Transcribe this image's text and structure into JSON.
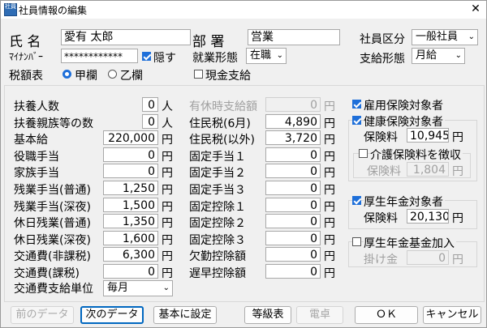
{
  "window": {
    "title": "社員情報の編集",
    "icon_text": "社員",
    "close_glyph": "✕"
  },
  "header": {
    "name_label": "氏 名",
    "name_value": "愛有 太郎",
    "mynumber_label": "ﾏｲﾅﾝﾊﾞｰ",
    "mynumber_value": "************",
    "hide_label": "隠す",
    "hide_checked": true,
    "tax_table_label": "税額表",
    "tax_kou": "甲欄",
    "tax_otsu": "乙欄",
    "tax_selected": "甲欄",
    "dept_label": "部 署",
    "dept_value": "営業",
    "employment_label": "就業形態",
    "employment_value": "在職",
    "cash_label": "現金支給",
    "cash_checked": false,
    "category_label": "社員区分",
    "category_value": "一般社員",
    "paytype_label": "支給形態",
    "paytype_value": "月給"
  },
  "col1": {
    "rows": [
      {
        "label": "扶養人数",
        "value": "0",
        "unit": "人"
      },
      {
        "label": "扶養親族等の数",
        "value": "0",
        "unit": "人"
      },
      {
        "label": "基本給",
        "value": "220,000",
        "unit": "円"
      },
      {
        "label": "役職手当",
        "value": "0",
        "unit": "円"
      },
      {
        "label": "家族手当",
        "value": "0",
        "unit": "円"
      },
      {
        "label": "残業手当(普通)",
        "value": "1,250",
        "unit": "円"
      },
      {
        "label": "残業手当(深夜)",
        "value": "1,500",
        "unit": "円"
      },
      {
        "label": "休日残業(普通)",
        "value": "1,350",
        "unit": "円"
      },
      {
        "label": "休日残業(深夜)",
        "value": "1,600",
        "unit": "円"
      },
      {
        "label": "交通費(非課税)",
        "value": "6,300",
        "unit": "円"
      },
      {
        "label": "交通費(課税)",
        "value": "0",
        "unit": "円"
      }
    ],
    "commute_unit_label": "交通費支給単位",
    "commute_unit_value": "毎月"
  },
  "col2": {
    "rows": [
      {
        "label": "有休時支給額",
        "value": "0",
        "unit": "円",
        "disabled": true
      },
      {
        "label": "住民税(6月)",
        "value": "4,890",
        "unit": "円"
      },
      {
        "label": "住民税(以外)",
        "value": "3,720",
        "unit": "円"
      },
      {
        "label": "固定手当１",
        "value": "0",
        "unit": "円"
      },
      {
        "label": "固定手当２",
        "value": "0",
        "unit": "円"
      },
      {
        "label": "固定手当３",
        "value": "0",
        "unit": "円"
      },
      {
        "label": "固定控除１",
        "value": "0",
        "unit": "円"
      },
      {
        "label": "固定控除２",
        "value": "0",
        "unit": "円"
      },
      {
        "label": "固定控除３",
        "value": "0",
        "unit": "円"
      },
      {
        "label": "欠勤控除額",
        "value": "0",
        "unit": "円"
      },
      {
        "label": "遅早控除額",
        "value": "0",
        "unit": "円"
      }
    ]
  },
  "insurance": {
    "employment_label": "雇用保険対象者",
    "employment_checked": true,
    "health_label": "健康保険対象者",
    "health_checked": true,
    "health_fee_label": "保険料",
    "health_fee_value": "10,945",
    "care_label": "介護保険料を徴収",
    "care_checked": false,
    "care_fee_label": "保険料",
    "care_fee_value": "1,804",
    "pension_label": "厚生年金対象者",
    "pension_checked": true,
    "pension_fee_label": "保険料",
    "pension_fee_value": "20,130",
    "fund_label": "厚生年金基金加入",
    "fund_checked": false,
    "fund_fee_label": "掛け金",
    "fund_fee_value": "0",
    "yen": "円"
  },
  "buttons": {
    "prev": "前のデータ",
    "next": "次のデータ",
    "basic": "基本に設定",
    "grade": "等級表",
    "calc": "電卓",
    "ok": "ＯＫ",
    "cancel": "キャンセル"
  },
  "icons": {
    "dropdown": "chevron-down-icon",
    "check": "check-icon"
  }
}
